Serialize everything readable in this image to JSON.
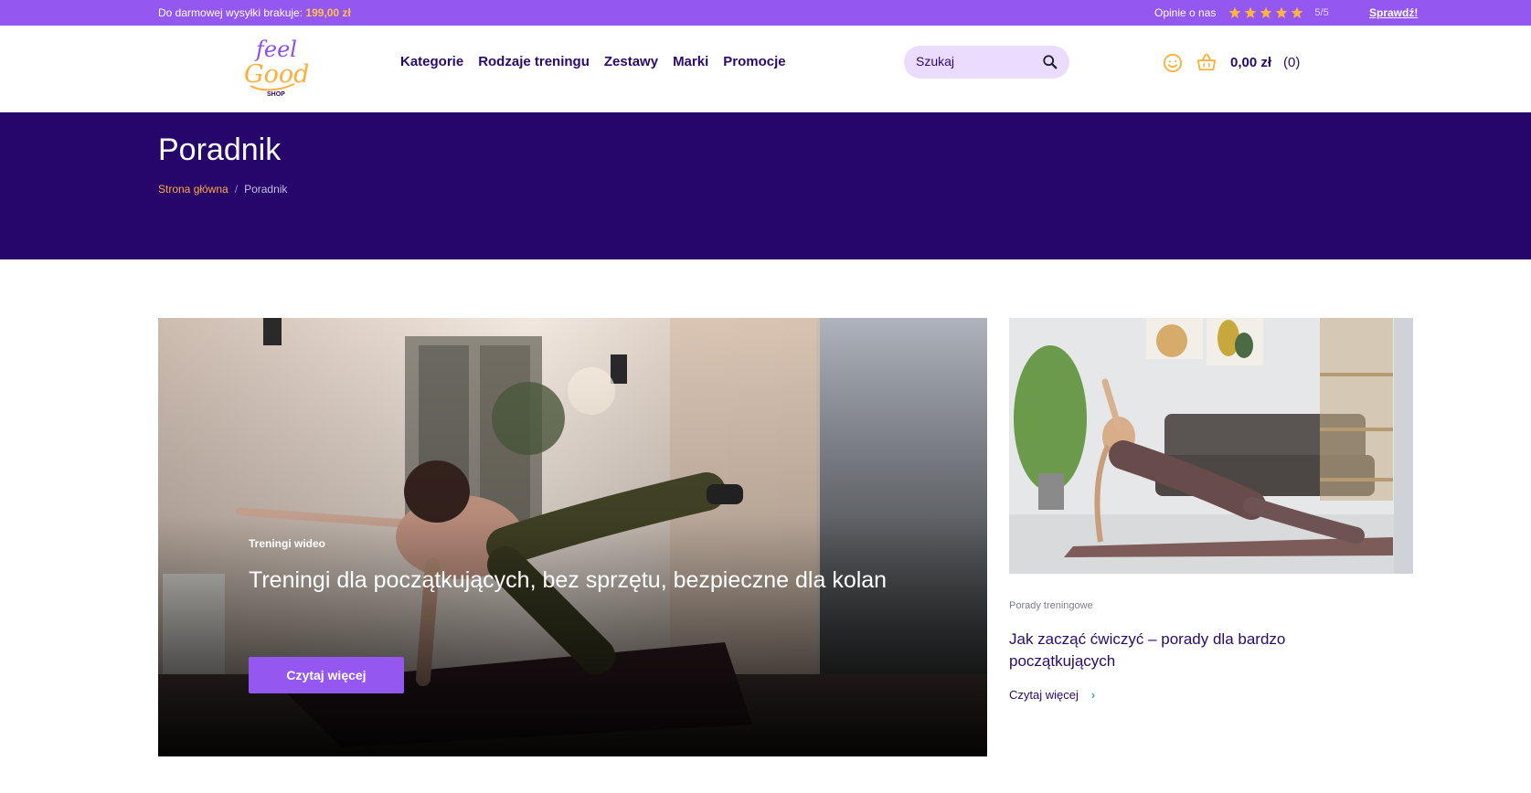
{
  "topbar": {
    "shipping_text": "Do darmowej wysyłki brakuje:",
    "shipping_amount": "199,00 zł",
    "reviews_label": "Opinie o nas",
    "rating": "5/5",
    "rating_value": 5,
    "check_link": "Sprawdź!"
  },
  "header": {
    "logo_text_top": "feel",
    "logo_text_mid": "Good",
    "logo_text_bottom": "SHOP",
    "nav": [
      "Kategorie",
      "Rodzaje treningu",
      "Zestawy",
      "Marki",
      "Promocje"
    ],
    "search_placeholder": "Szukaj",
    "cart_total": "0,00 zł",
    "cart_count": "(0)"
  },
  "hero": {
    "title": "Poradnik",
    "breadcrumb_home": "Strona główna",
    "breadcrumb_sep": "/",
    "breadcrumb_current": "Poradnik"
  },
  "featured": {
    "category": "Treningi wideo",
    "title": "Treningi dla początkujących, bez sprzętu, bezpieczne dla kolan",
    "button": "Czytaj więcej"
  },
  "side": {
    "category": "Porady treningowe",
    "title": "Jak zacząć ćwiczyć – porady dla bardzo początkujących",
    "more": "Czytaj więcej",
    "chevron": "›"
  },
  "colors": {
    "topbar_bg": "#9457f0",
    "hero_bg": "#27066b",
    "accent_orange": "#ffa83d",
    "button_purple": "#9457f0",
    "text_dark": "#2a0a6b"
  }
}
